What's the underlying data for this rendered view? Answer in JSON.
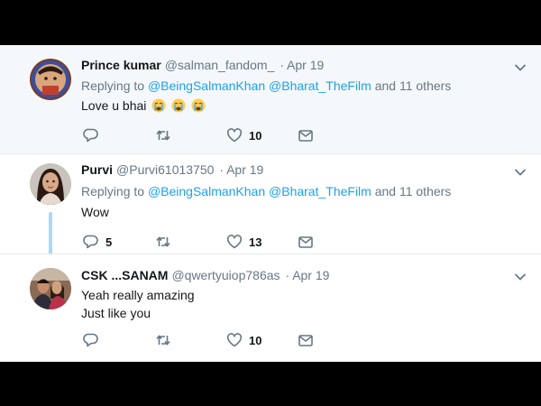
{
  "tweets": [
    {
      "name": "Prince kumar",
      "handle": "@salman_fandom_",
      "date": "Apr 19",
      "replying_prefix": "Replying to",
      "mentions": [
        "@BeingSalmanKhan",
        "@Bharat_TheFilm"
      ],
      "replying_suffix": "and 11 others",
      "text": "Love u bhai",
      "emojis": [
        "crying-face",
        "crying-face",
        "crying-face"
      ],
      "reply_count": "",
      "like_count": "10"
    },
    {
      "name": "Purvi",
      "handle": "@Purvi61013750",
      "date": "Apr 19",
      "replying_prefix": "Replying to",
      "mentions": [
        "@BeingSalmanKhan",
        "@Bharat_TheFilm"
      ],
      "replying_suffix": "and 11 others",
      "text": "Wow",
      "reply_count": "5",
      "like_count": "13"
    },
    {
      "name": "CSK ...SANAM",
      "handle": "@qwertyuiop786as",
      "date": "Apr 19",
      "text_lines": [
        "Yeah really amazing",
        "Just like you"
      ],
      "reply_count": "",
      "like_count": "10"
    }
  ],
  "colors": {
    "link": "#1da1f2",
    "secondary_text": "#657786",
    "primary_text": "#14171a",
    "thread_line": "#a9d9f8",
    "highlight_bg": "#f5f8fa"
  }
}
